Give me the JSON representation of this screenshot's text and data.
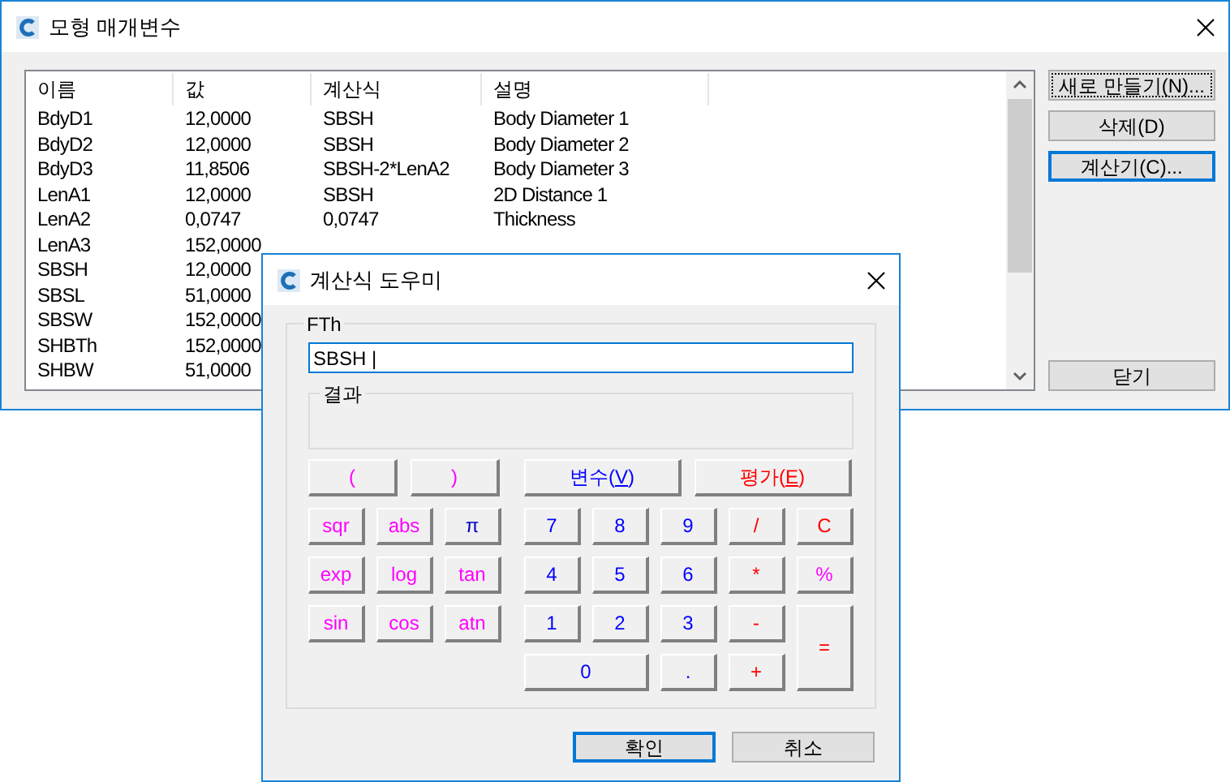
{
  "main_window": {
    "title": "모형 매개변수",
    "table": {
      "columns": [
        "이름",
        "값",
        "계산식",
        "설명"
      ],
      "rows": [
        [
          "BdyD1",
          "12,0000",
          "SBSH",
          "Body Diameter 1"
        ],
        [
          "BdyD2",
          "12,0000",
          "SBSH",
          "Body Diameter 2"
        ],
        [
          "BdyD3",
          "11,8506",
          "SBSH-2*LenA2",
          "Body Diameter 3"
        ],
        [
          "LenA1",
          "12,0000",
          "SBSH",
          "2D Distance 1"
        ],
        [
          "LenA2",
          "0,0747",
          "0,0747",
          "Thickness"
        ],
        [
          "LenA3",
          "152,0000"
        ],
        [
          "SBSH",
          "12,0000"
        ],
        [
          "SBSL",
          "51,0000"
        ],
        [
          "SBSW",
          "152,0000"
        ],
        [
          "SHBTh",
          "152,0000"
        ],
        [
          "SHBW",
          "51,0000"
        ]
      ]
    },
    "buttons": [
      {
        "label": "새로 만들기(N)...",
        "kind": "focus"
      },
      {
        "label": "삭제(D)",
        "kind": "plain"
      },
      {
        "label": "계산기(C)...",
        "kind": "default"
      }
    ],
    "close_button": {
      "label": "닫기"
    }
  },
  "dialog": {
    "title": "계산식 도우미",
    "group_label": "FTh",
    "expression": "SBSH |",
    "result_label": "결과",
    "top_keys": [
      {
        "label": [
          "("
        ],
        "kind": "function"
      },
      {
        "label": [
          ")"
        ],
        "kind": "function"
      },
      {
        "label": [
          "변수(",
          "V",
          ")"
        ],
        "kind": "digit"
      },
      {
        "label": [
          "평가(",
          "E",
          ")"
        ],
        "kind": "operator"
      }
    ],
    "function_keys": [
      {
        "label": "sqr",
        "kind": "function"
      },
      {
        "label": "abs",
        "kind": "function"
      },
      {
        "label": "π",
        "kind": "constant"
      },
      {
        "label": "exp",
        "kind": "function"
      },
      {
        "label": "log",
        "kind": "function"
      },
      {
        "label": "tan",
        "kind": "function"
      },
      {
        "label": "sin",
        "kind": "function"
      },
      {
        "label": "cos",
        "kind": "function"
      },
      {
        "label": "atn",
        "kind": "function"
      }
    ],
    "keypad": [
      {
        "label": "7",
        "kind": "digit"
      },
      {
        "label": "8",
        "kind": "digit"
      },
      {
        "label": "9",
        "kind": "digit"
      },
      {
        "label": "/",
        "kind": "operator"
      },
      {
        "label": "C",
        "kind": "operator"
      },
      {
        "label": "4",
        "kind": "digit"
      },
      {
        "label": "5",
        "kind": "digit"
      },
      {
        "label": "6",
        "kind": "digit"
      },
      {
        "label": "*",
        "kind": "operator"
      },
      {
        "label": "%",
        "kind": "function"
      },
      {
        "label": "1",
        "kind": "digit"
      },
      {
        "label": "2",
        "kind": "digit"
      },
      {
        "label": "3",
        "kind": "digit"
      },
      {
        "label": "-",
        "kind": "operator"
      },
      {
        "label": "=",
        "kind": "operator",
        "tall": true
      },
      {
        "label": "0",
        "kind": "digit",
        "wide": true
      },
      {
        "label": ".",
        "kind": "digit"
      },
      {
        "label": "+",
        "kind": "operator"
      }
    ],
    "buttons": [
      {
        "label": "확인",
        "kind": "default"
      },
      {
        "label": "취소",
        "kind": "plain"
      }
    ]
  }
}
